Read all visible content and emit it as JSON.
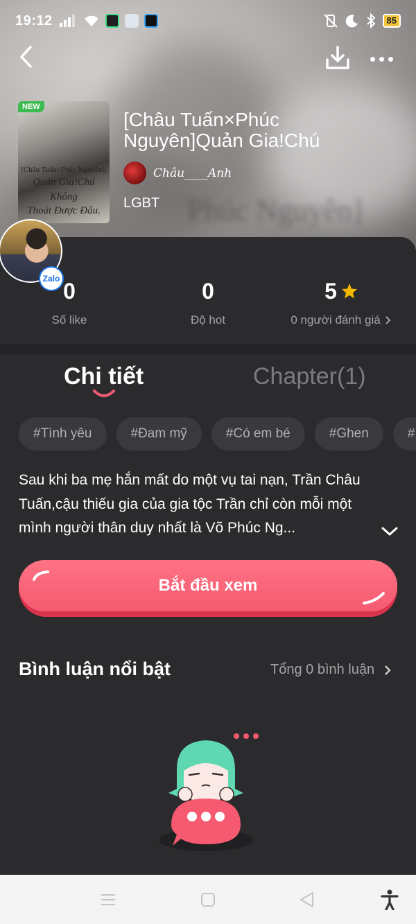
{
  "status_bar": {
    "time": "19:12",
    "battery": "85"
  },
  "book": {
    "badge": "NEW",
    "cover_line1": "[Châu Tuấn×Phúc Nguyên].",
    "cover_line2": "Quản Gia!Chú Không",
    "cover_line3": "Thoát Được Đâu.",
    "title": "[Châu Tuấn×Phúc Nguyên]Quản Gia!Chú",
    "author": "Châu____Anh",
    "genre": "LGBT",
    "blurred_background_text": "Phúc Nguyên]"
  },
  "floating_widget": {
    "badge": "Zalo"
  },
  "stats": [
    {
      "value": "0",
      "label": "Số like"
    },
    {
      "value": "0",
      "label": "Độ hot"
    },
    {
      "value": "5",
      "label": "0 người đánh giá"
    }
  ],
  "tabs": [
    {
      "label": "Chi tiết",
      "active": true
    },
    {
      "label": "Chapter(1)",
      "active": false
    }
  ],
  "tags": [
    "#Tình yêu",
    "#Đam mỹ",
    "#Có em bé",
    "#Ghen",
    "#"
  ],
  "description": "Sau khi ba mẹ hắn mất do một vụ tai nạn, Trần Châu Tuấn,cậu thiếu gia của gia tộc Trần chỉ còn mỗi một mình người thân duy nhất là Võ Phúc Ng...",
  "start_button": "Bắt đầu xem",
  "comments": {
    "title": "Bình luận nổi bật",
    "total": "Tổng 0 bình luận"
  },
  "colors": {
    "accent": "#f55a70",
    "panel": "#2b2b2d",
    "star": "#f5b700"
  }
}
